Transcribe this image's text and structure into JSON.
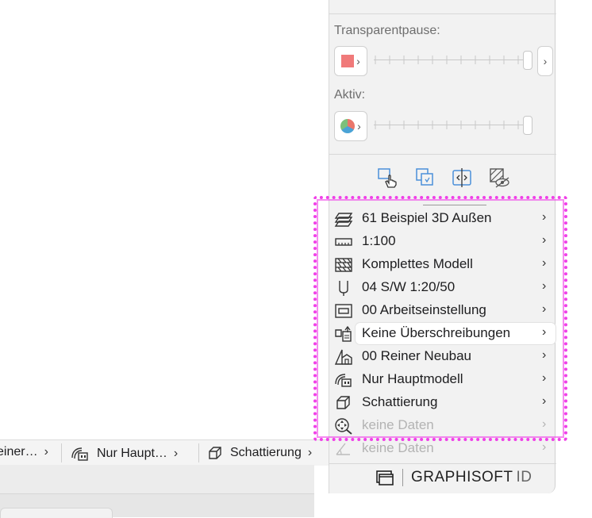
{
  "panel": {
    "transparent_label": "Transparentpause:",
    "active_label": "Aktiv:",
    "chevron": "›",
    "tool_icons": [
      "hand-pointer-icon",
      "copy-icon",
      "mirror-icon",
      "hatch-hide-icon"
    ]
  },
  "view_settings": [
    {
      "icon": "layers-icon",
      "label": "61 Beispiel 3D Außen"
    },
    {
      "icon": "ruler-icon",
      "label": "1:100"
    },
    {
      "icon": "filmstrip-icon",
      "label": "Komplettes Modell"
    },
    {
      "icon": "pen-icon",
      "label": "04 S/W 1:20/50"
    },
    {
      "icon": "frame-icon",
      "label": "00 Arbeitseinstellung"
    },
    {
      "icon": "override-icon",
      "label": "Keine Überschreibungen"
    },
    {
      "icon": "renovation-icon",
      "label": "00 Reiner Neubau"
    },
    {
      "icon": "model-filter-icon",
      "label": "Nur Hauptmodell"
    },
    {
      "icon": "shading-cube-icon",
      "label": "Schattierung"
    },
    {
      "icon": "zoom-target-icon",
      "label": "keine Daten"
    },
    {
      "icon": "angle-icon",
      "label": "keine Daten"
    }
  ],
  "statusbar": {
    "item1": "einer…",
    "item2": "Nur Haupt…",
    "item3": "Schattierung"
  },
  "footer": {
    "brand": "GRAPHISOFT",
    "brand_id": "ID"
  },
  "colors": {
    "highlight": "#f040e8",
    "swatch": "#f07a7a",
    "accent_icon": "#4a90d9"
  }
}
